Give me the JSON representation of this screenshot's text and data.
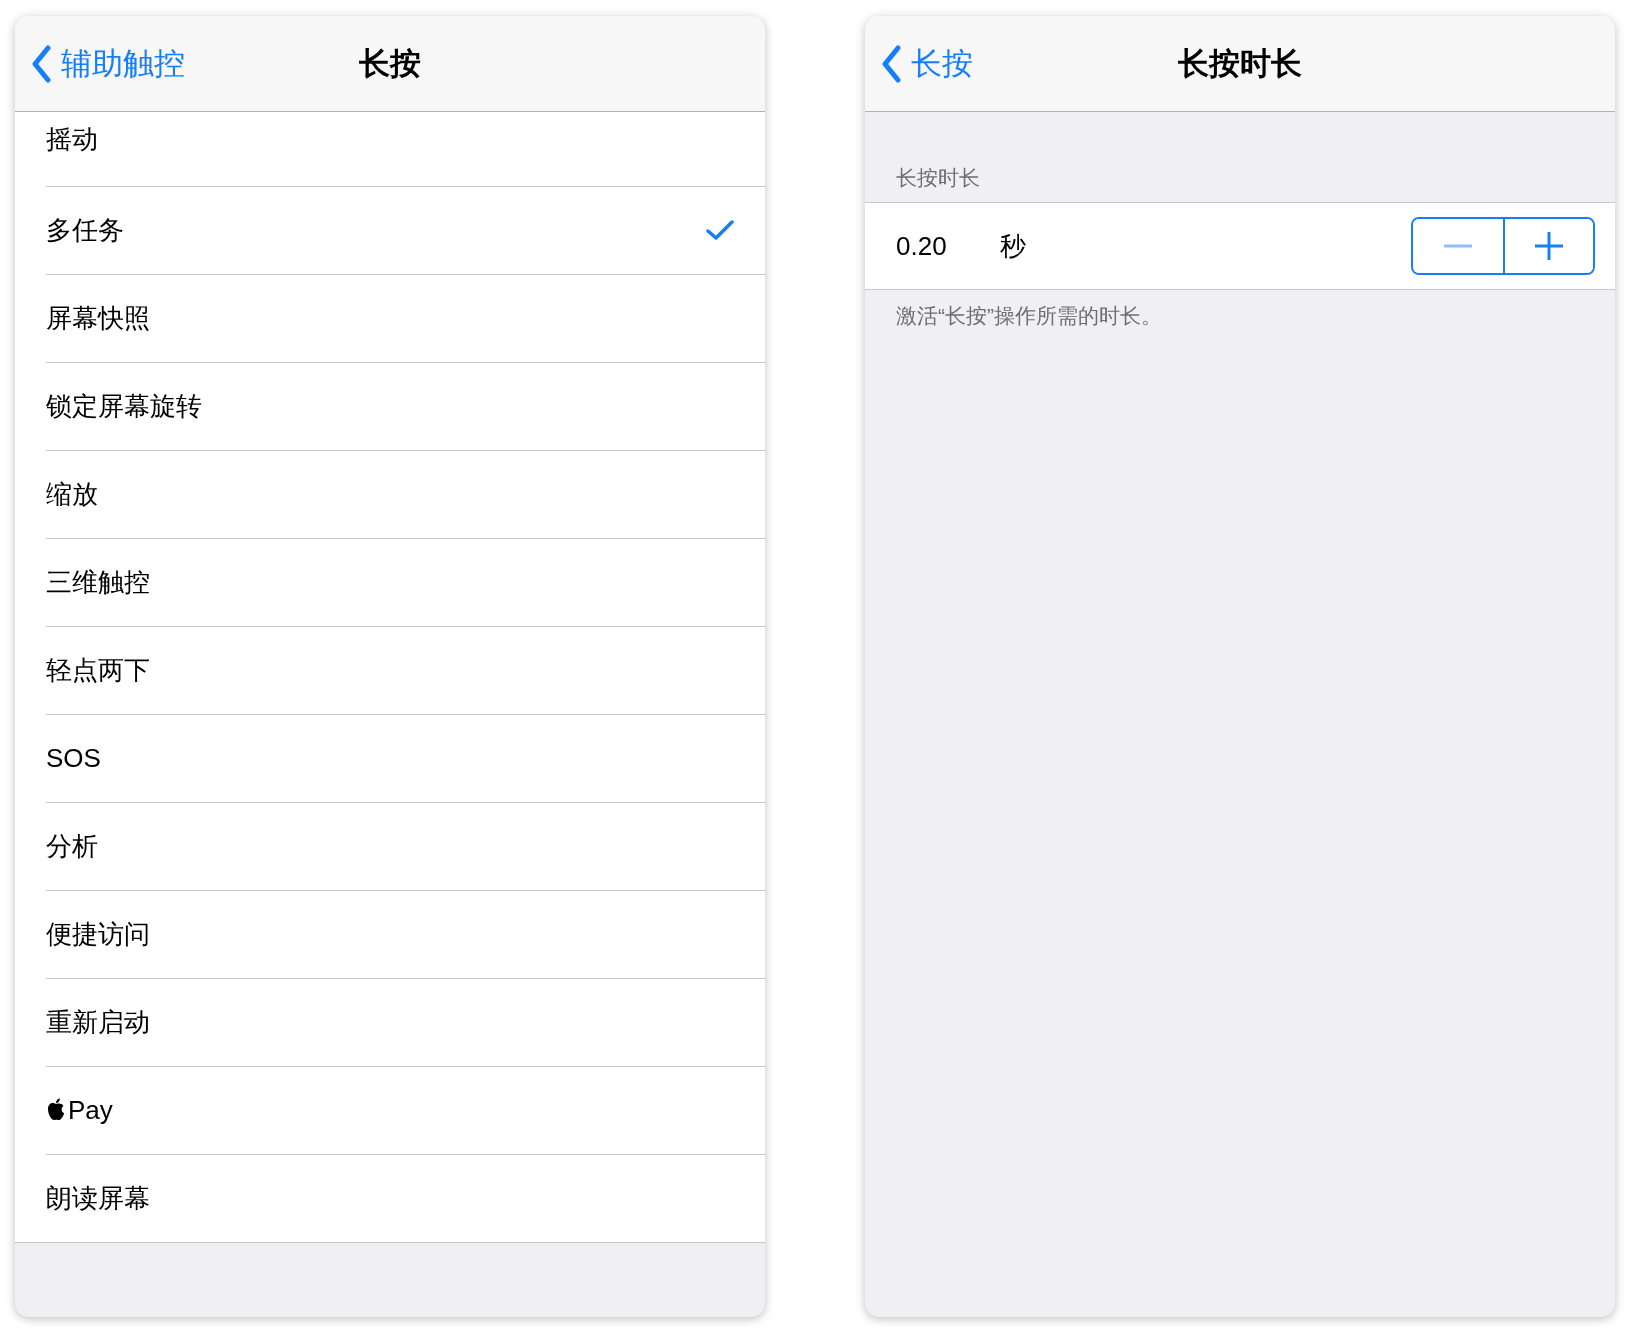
{
  "left_panel": {
    "nav_bar": {
      "back_label": "辅助触控",
      "title": "长按"
    },
    "items": [
      {
        "kind": "text",
        "label": "摇动",
        "checked": false
      },
      {
        "kind": "text",
        "label": "多任务",
        "checked": true
      },
      {
        "kind": "text",
        "label": "屏幕快照",
        "checked": false
      },
      {
        "kind": "text",
        "label": "锁定屏幕旋转",
        "checked": false
      },
      {
        "kind": "text",
        "label": "缩放",
        "checked": false
      },
      {
        "kind": "text",
        "label": "三维触控",
        "checked": false
      },
      {
        "kind": "text",
        "label": "轻点两下",
        "checked": false
      },
      {
        "kind": "text",
        "label": "SOS",
        "checked": false
      },
      {
        "kind": "text",
        "label": "分析",
        "checked": false
      },
      {
        "kind": "text",
        "label": "便捷访问",
        "checked": false
      },
      {
        "kind": "text",
        "label": "重新启动",
        "checked": false
      },
      {
        "kind": "apple_pay",
        "label": "Pay",
        "checked": false
      },
      {
        "kind": "text",
        "label": "朗读屏幕",
        "checked": false
      }
    ]
  },
  "right_panel": {
    "nav_bar": {
      "back_label": "长按",
      "title": "长按时长"
    },
    "section_header": "长按时长",
    "row": {
      "value": "0.20",
      "unit": "秒",
      "stepper": [
        {
          "kind": "decrement",
          "disabled": true
        },
        {
          "kind": "increment",
          "disabled": false
        }
      ]
    },
    "section_footer": "激活“长按”操作所需的时长。"
  }
}
